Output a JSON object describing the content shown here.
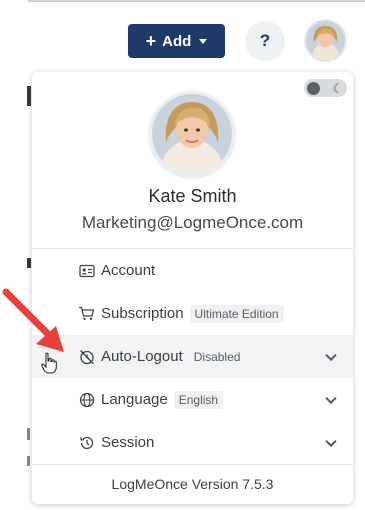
{
  "toolbar": {
    "add_label": "Add",
    "help_label": "?"
  },
  "profile": {
    "name": "Kate Smith",
    "email": "Marketing@LogmeOnce.com"
  },
  "menu": {
    "account": {
      "label": "Account",
      "icon": "id-card-icon"
    },
    "subscription": {
      "label": "Subscription",
      "badge": "Ultimate Edition",
      "icon": "cart-icon"
    },
    "auto_logout": {
      "label": "Auto-Logout",
      "badge": "Disabled",
      "icon": "timer-off-icon"
    },
    "language": {
      "label": "Language",
      "badge": "English",
      "icon": "globe-icon"
    },
    "session": {
      "label": "Session",
      "icon": "history-icon"
    }
  },
  "footer": {
    "version": "LogMeOnce Version 7.5.3"
  },
  "colors": {
    "brand_navy": "#1f3a68",
    "highlight_row": "#f1f3f4",
    "annotation_arrow": "#e8413a"
  }
}
